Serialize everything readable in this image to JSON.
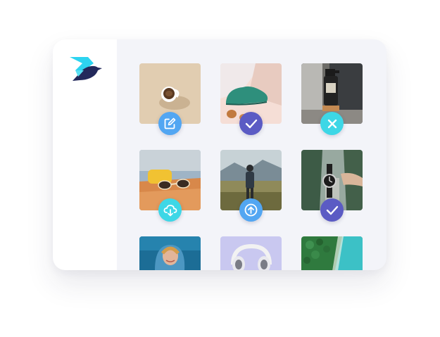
{
  "app": {
    "logo_icon": "bird-arrow-logo",
    "colors": {
      "logo_cyan": "#2dd4f0",
      "logo_navy": "#23295b",
      "badge_blue": "#52a6f2",
      "badge_cyan": "#3dd7e6",
      "badge_purple": "#5b5bc4",
      "panel": "#f3f4f9"
    }
  },
  "gallery": {
    "items": [
      {
        "subject": "coffee-cup-photo",
        "status_icon": "edit-icon",
        "status_color": "#52a6f2"
      },
      {
        "subject": "green-shoe-photo",
        "status_icon": "check-icon",
        "status_color": "#5b5bc4"
      },
      {
        "subject": "spray-bottle-photo",
        "status_icon": "close-icon",
        "status_color": "#3dd7e6"
      },
      {
        "subject": "sunglasses-photo",
        "status_icon": "cloud-download-icon",
        "status_color": "#3dd7e6"
      },
      {
        "subject": "person-in-field-photo",
        "status_icon": "upload-icon",
        "status_color": "#52a6f2"
      },
      {
        "subject": "wristwatch-photo",
        "status_icon": "check-icon",
        "status_color": "#5b5bc4"
      },
      {
        "subject": "smiling-woman-photo",
        "status_icon": "",
        "status_color": ""
      },
      {
        "subject": "headphones-photo",
        "status_icon": "",
        "status_color": ""
      },
      {
        "subject": "forest-aerial-photo",
        "status_icon": "",
        "status_color": ""
      }
    ]
  }
}
